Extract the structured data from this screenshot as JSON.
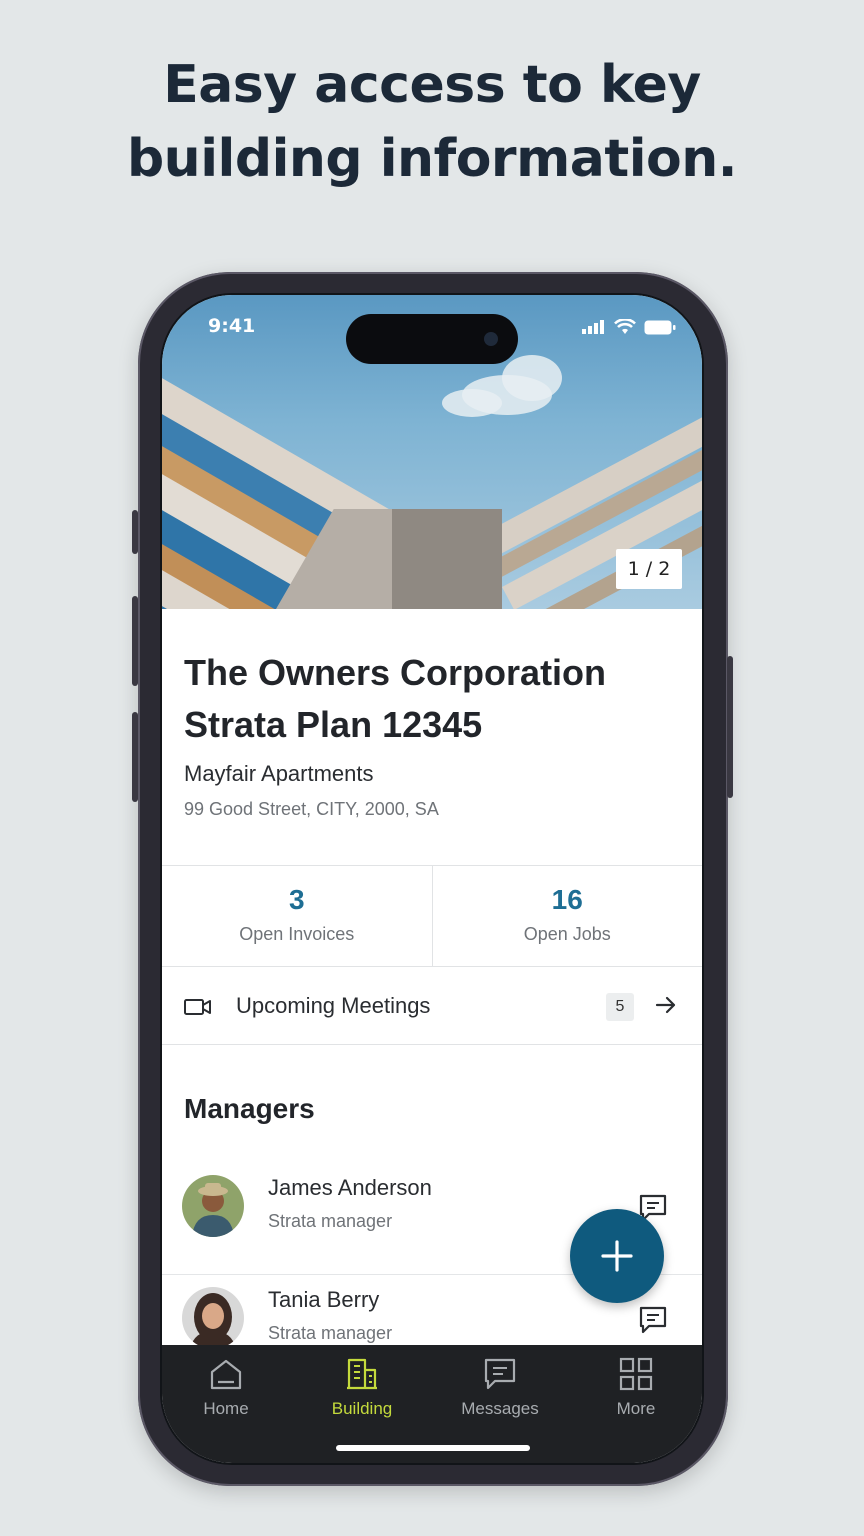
{
  "headline": {
    "line1": "Easy access to key",
    "line2": "building information."
  },
  "status_bar": {
    "time": "9:41",
    "icons": [
      "signal-icon",
      "wifi-icon",
      "battery-icon"
    ]
  },
  "hero": {
    "counter": "1 / 2"
  },
  "building": {
    "title_line1": "The Owners Corporation",
    "title_line2": "Strata Plan 12345",
    "name": "Mayfair Apartments",
    "address": "99 Good Street, CITY, 2000, SA"
  },
  "stats": [
    {
      "value": "3",
      "label": "Open Invoices"
    },
    {
      "value": "16",
      "label": "Open Jobs"
    }
  ],
  "meetings": {
    "label": "Upcoming Meetings",
    "count": "5",
    "icon": "video-icon"
  },
  "managers": {
    "title": "Managers",
    "items": [
      {
        "name": "James Anderson",
        "role": "Strata manager"
      },
      {
        "name": "Tania Berry",
        "role": "Strata manager"
      }
    ]
  },
  "nav": {
    "items": [
      {
        "label": "Home",
        "icon": "home-icon"
      },
      {
        "label": "Building",
        "icon": "building-icon",
        "active": true
      },
      {
        "label": "Messages",
        "icon": "message-icon"
      },
      {
        "label": "More",
        "icon": "grid-icon"
      }
    ]
  },
  "colors": {
    "background": "#e3e7e8",
    "headline": "#1c2938",
    "accent_blue": "#1e6e94",
    "fab": "#0f5a7e",
    "nav_bg": "#1f2124",
    "nav_active": "#c4da3c"
  }
}
